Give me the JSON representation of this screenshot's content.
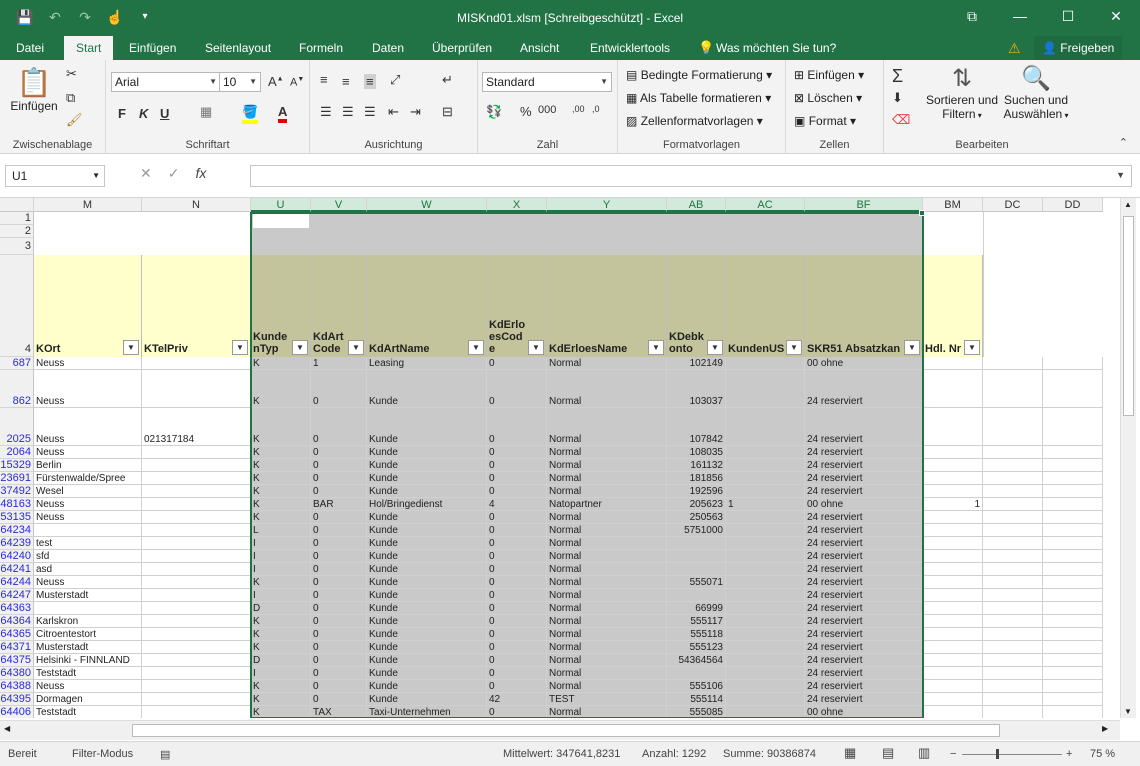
{
  "window": {
    "title": "MISKnd01.xlsm  [Schreibgeschützt] - Excel",
    "controls": [
      "ribbon-options-icon",
      "minimize-icon",
      "maximize-icon",
      "close-icon"
    ]
  },
  "tabs": {
    "file": "Datei",
    "start": "Start",
    "insert": "Einfügen",
    "layout": "Seitenlayout",
    "formulas": "Formeln",
    "data": "Daten",
    "review": "Überprüfen",
    "view": "Ansicht",
    "dev": "Entwicklertools",
    "tellme": "Was möchten Sie tun?",
    "share": "Freigeben"
  },
  "ribbon": {
    "clipboard": {
      "label": "Zwischenablage",
      "paste": "Einfügen"
    },
    "font": {
      "label": "Schriftart",
      "name": "Arial",
      "size": "10",
      "bold": "F",
      "italic": "K",
      "underline": "U"
    },
    "alignment": {
      "label": "Ausrichtung"
    },
    "number": {
      "label": "Zahl",
      "format": "Standard"
    },
    "styles": {
      "label": "Formatvorlagen",
      "conditional": "Bedingte Formatierung",
      "as_table": "Als Tabelle formatieren",
      "cell_styles": "Zellenformatvorlagen"
    },
    "cells": {
      "label": "Zellen",
      "insert": "Einfügen",
      "delete": "Löschen",
      "format": "Format"
    },
    "editing": {
      "label": "Bearbeiten",
      "sort1": "Sortieren und",
      "sort2": "Filtern",
      "find1": "Suchen und",
      "find2": "Auswählen"
    }
  },
  "formula_bar": {
    "name_box": "U1",
    "cancel": "✕",
    "enter": "✓",
    "fx": "fx",
    "content": ""
  },
  "columns": [
    "M",
    "N",
    "U",
    "V",
    "W",
    "X",
    "Y",
    "AB",
    "AC",
    "BF",
    "BM",
    "DC",
    "DD"
  ],
  "row_headers_top": [
    "1",
    "2",
    "3",
    "4"
  ],
  "table_headers": [
    "KOrt",
    "KTelPriv",
    "KundenTyp",
    "KdArtCode",
    "KdArtName",
    "KdErloesCode",
    "KdErloesName",
    "KDebkonto",
    "KundenUS",
    "SKR51 Absatzkan",
    "Hdl. Nr"
  ],
  "rows": [
    {
      "n": "687",
      "c": [
        "Neuss",
        "",
        "K",
        "1",
        "Leasing",
        "0",
        "Normal",
        "102149",
        "",
        "00 ohne",
        ""
      ]
    },
    {
      "n": "862",
      "c": [
        "Neuss",
        "",
        "K",
        "0",
        "Kunde",
        "0",
        "Normal",
        "103037",
        "",
        "24 reserviert",
        ""
      ]
    },
    {
      "n": "2025",
      "c": [
        "Neuss",
        "021317184",
        "K",
        "0",
        "Kunde",
        "0",
        "Normal",
        "107842",
        "",
        "24 reserviert",
        ""
      ]
    },
    {
      "n": "2064",
      "c": [
        "Neuss",
        "",
        "K",
        "0",
        "Kunde",
        "0",
        "Normal",
        "108035",
        "",
        "24 reserviert",
        ""
      ]
    },
    {
      "n": "15329",
      "c": [
        "Berlin",
        "",
        "K",
        "0",
        "Kunde",
        "0",
        "Normal",
        "161132",
        "",
        "24 reserviert",
        ""
      ]
    },
    {
      "n": "23691",
      "c": [
        "Fürstenwalde/Spree",
        "",
        "K",
        "0",
        "Kunde",
        "0",
        "Normal",
        "181856",
        "",
        "24 reserviert",
        ""
      ]
    },
    {
      "n": "37492",
      "c": [
        "Wesel",
        "",
        "K",
        "0",
        "Kunde",
        "0",
        "Normal",
        "192596",
        "",
        "24 reserviert",
        ""
      ]
    },
    {
      "n": "48163",
      "c": [
        "Neuss",
        "",
        "K",
        "BAR",
        "Hol/Bringedienst",
        "4",
        "Natopartner",
        "205623",
        "1",
        "00 ohne",
        "1"
      ]
    },
    {
      "n": "53135",
      "c": [
        "Neuss",
        "",
        "K",
        "0",
        "Kunde",
        "0",
        "Normal",
        "250563",
        "",
        "24 reserviert",
        ""
      ]
    },
    {
      "n": "64234",
      "c": [
        "",
        "",
        "L",
        "0",
        "Kunde",
        "0",
        "Normal",
        "5751000",
        "",
        "24 reserviert",
        ""
      ]
    },
    {
      "n": "64239",
      "c": [
        "test",
        "",
        "I",
        "0",
        "Kunde",
        "0",
        "Normal",
        "",
        "",
        "24 reserviert",
        ""
      ]
    },
    {
      "n": "64240",
      "c": [
        "sfd",
        "",
        "I",
        "0",
        "Kunde",
        "0",
        "Normal",
        "",
        "",
        "24 reserviert",
        ""
      ]
    },
    {
      "n": "64241",
      "c": [
        "asd",
        "",
        "I",
        "0",
        "Kunde",
        "0",
        "Normal",
        "",
        "",
        "24 reserviert",
        ""
      ]
    },
    {
      "n": "64244",
      "c": [
        "Neuss",
        "",
        "K",
        "0",
        "Kunde",
        "0",
        "Normal",
        "555071",
        "",
        "24 reserviert",
        ""
      ]
    },
    {
      "n": "64247",
      "c": [
        "Musterstadt",
        "",
        "I",
        "0",
        "Kunde",
        "0",
        "Normal",
        "",
        "",
        "24 reserviert",
        ""
      ]
    },
    {
      "n": "64363",
      "c": [
        "",
        "",
        "D",
        "0",
        "Kunde",
        "0",
        "Normal",
        "66999",
        "",
        "24 reserviert",
        ""
      ]
    },
    {
      "n": "64364",
      "c": [
        "Karlskron",
        "",
        "K",
        "0",
        "Kunde",
        "0",
        "Normal",
        "555117",
        "",
        "24 reserviert",
        ""
      ]
    },
    {
      "n": "64365",
      "c": [
        "Citroentestort",
        "",
        "K",
        "0",
        "Kunde",
        "0",
        "Normal",
        "555118",
        "",
        "24 reserviert",
        ""
      ]
    },
    {
      "n": "64371",
      "c": [
        "Musterstadt",
        "",
        "K",
        "0",
        "Kunde",
        "0",
        "Normal",
        "555123",
        "",
        "24 reserviert",
        ""
      ]
    },
    {
      "n": "64375",
      "c": [
        "Helsinki - FINNLAND",
        "",
        "D",
        "0",
        "Kunde",
        "0",
        "Normal",
        "54364564",
        "",
        "24 reserviert",
        ""
      ]
    },
    {
      "n": "64380",
      "c": [
        "Teststadt",
        "",
        "I",
        "0",
        "Kunde",
        "0",
        "Normal",
        "",
        "",
        "24 reserviert",
        ""
      ]
    },
    {
      "n": "64388",
      "c": [
        "Neuss",
        "",
        "K",
        "0",
        "Kunde",
        "0",
        "Normal",
        "555106",
        "",
        "24 reserviert",
        ""
      ]
    },
    {
      "n": "64395",
      "c": [
        "Dormagen",
        "",
        "K",
        "0",
        "Kunde",
        "42",
        "TEST",
        "555114",
        "",
        "24 reserviert",
        ""
      ]
    },
    {
      "n": "64406",
      "c": [
        "Teststadt",
        "",
        "K",
        "TAX",
        "Taxi-Unternehmen",
        "0",
        "Normal",
        "555085",
        "",
        "00 ohne",
        ""
      ]
    }
  ],
  "status": {
    "ready": "Bereit",
    "filter": "Filter-Modus",
    "avg": "Mittelwert: 347641,8231",
    "count": "Anzahl: 1292",
    "sum": "Summe: 90386874",
    "zoom": "75 %"
  },
  "colors": {
    "accent": "#217346",
    "selected_fill": "#c9c9c9",
    "header_fill_yellow": "#ffffcc",
    "header_fill_olive": "#c4c49c"
  }
}
